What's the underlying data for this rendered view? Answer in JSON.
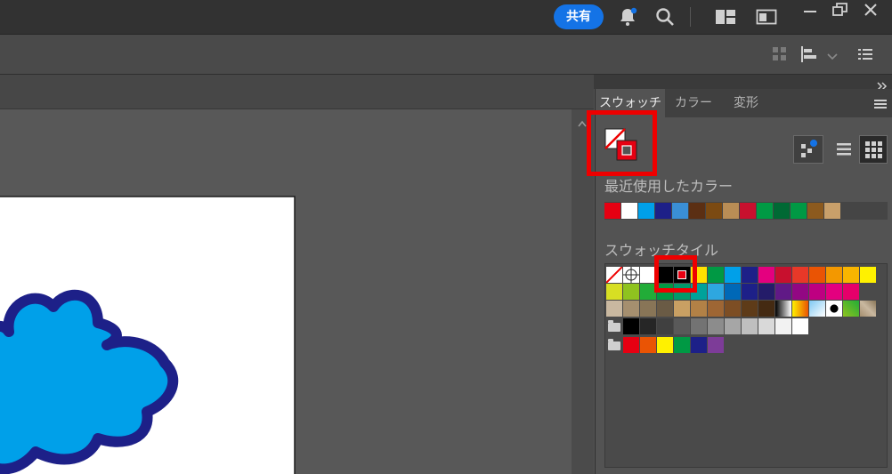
{
  "topbar": {
    "share_label": "共有"
  },
  "panel": {
    "tabs": [
      "スウォッチ",
      "カラー",
      "変形"
    ],
    "recent_colors_label": "最近使用したカラー",
    "swatch_tile_label": "スウォッチタイル",
    "recent_colors": [
      "#e60012",
      "#ffffff",
      "#00a0e9",
      "#1d2088",
      "#3a8fd6",
      "#5b2f13",
      "#7b4a12",
      "#b98d55",
      "#c8102e",
      "#009a44",
      "#006934",
      "#009944",
      "#8c5a1e",
      "#c9a06a"
    ],
    "swatch_rows": [
      [
        "none",
        "registration",
        "#ffffff",
        "#000000",
        "selected",
        "#ffe100",
        "#009944",
        "#00a0e9",
        "#1d2088",
        "#e4007f",
        "#c8102e",
        "#e83828",
        "#ea5404",
        "#f39800",
        "#f8b500",
        "#fff100"
      ],
      [
        "#d7df23",
        "#8fc31f",
        "#22ac38",
        "#009944",
        "#009b6b",
        "#00a29a",
        "#2ea7e0",
        "#0068b7",
        "#1d2088",
        "#241c69",
        "#601986",
        "#920783",
        "#be0081",
        "#e4007f",
        "#e5006a"
      ],
      [
        "#c9b8a0",
        "#a58f6f",
        "#887557",
        "#6a5b45",
        "#c9a063",
        "#b28146",
        "#9e6634",
        "#7d4e24",
        "#5e3b18",
        "#442a12",
        "gradient-bw",
        "gradient-orange",
        "gradient-blue",
        "pattern-dots",
        "pattern-green",
        "pattern-texture"
      ]
    ],
    "gray_group": [
      "#000000",
      "#262626",
      "#404040",
      "#595959",
      "#737373",
      "#8c8c8c",
      "#a6a6a6",
      "#bfbfbf",
      "#d9d9d9",
      "#f2f2f2",
      "#ffffff"
    ],
    "color_group": [
      "#e60012",
      "#ea5404",
      "#fff100",
      "#009944",
      "#1d2088",
      "#7d3c98"
    ]
  }
}
